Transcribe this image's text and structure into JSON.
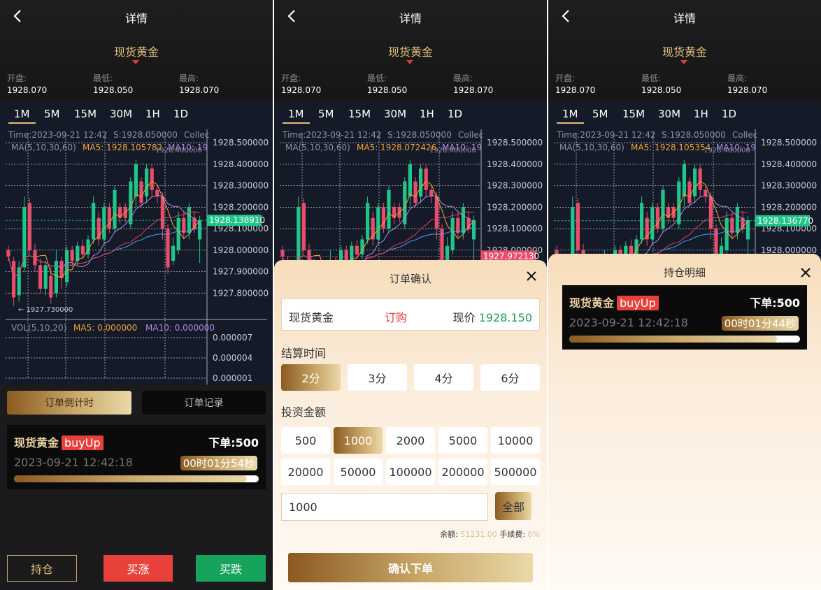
{
  "screens": [
    {
      "header": {
        "title": "详情",
        "symbol": "现货黄金"
      },
      "stats": [
        {
          "label": "开盘:",
          "value": "1928.070"
        },
        {
          "label": "最低:",
          "value": "1928.050"
        },
        {
          "label": "最高:",
          "value": "1928.070"
        }
      ],
      "timeframes": [
        "1M",
        "5M",
        "15M",
        "30M",
        "1H",
        "1D"
      ],
      "info_line": {
        "time": "Time:2023-09-21 12:42",
        "s": "S:1928.050000",
        "extra": "Collec"
      },
      "ma_line": {
        "label": "MA(5,10,30,60)",
        "ma5": "MA5: 1928.105782",
        "ma10": "MA10: 19"
      },
      "last_price": "1928.138910",
      "high_mark": "1928.400000",
      "low_mark": "1927.730000"
    },
    {
      "header": {
        "title": "详情",
        "symbol": "现货黄金"
      },
      "stats": [
        {
          "label": "开盘:",
          "value": "1928.070"
        },
        {
          "label": "最低:",
          "value": "1928.050"
        },
        {
          "label": "最高:",
          "value": "1928.070"
        }
      ],
      "timeframes": [
        "1M",
        "5M",
        "15M",
        "30M",
        "1H",
        "1D"
      ],
      "info_line": {
        "time": "Time:2023-09-21 12:42",
        "s": "S:1928.050000",
        "extra": "Collec"
      },
      "ma_line": {
        "label": "MA(5,10,30,60)",
        "ma5": "MA5: 1928.072426",
        "ma10": "MA10: 19"
      },
      "last_price": "1927.972130",
      "high_mark": "1928.400000"
    },
    {
      "header": {
        "title": "详情",
        "symbol": "现货黄金"
      },
      "stats": [
        {
          "label": "开盘:",
          "value": "1928.070"
        },
        {
          "label": "最低:",
          "value": "1928.050"
        },
        {
          "label": "最高:",
          "value": "1928.070"
        }
      ],
      "timeframes": [
        "1M",
        "5M",
        "15M",
        "30M",
        "1H",
        "1D"
      ],
      "info_line": {
        "time": "Time:2023-09-21 12:42",
        "s": "S:1928.050000",
        "extra": "Collec"
      },
      "ma_line": {
        "label": "MA(5,10,30,60)",
        "ma5": "MA5: 1928.105354",
        "ma10": "MA10: 19"
      },
      "last_price": "1928.136770",
      "high_mark": "1928.400000"
    }
  ],
  "y_ticks": [
    "1928.500000",
    "1928.400000",
    "1928.300000",
    "1928.200000",
    "1928.100000",
    "1928.000000",
    "1927.900000",
    "1927.800000"
  ],
  "vol": {
    "label": "VOL(5,10,20)",
    "ma5": "MA5: 0.000000",
    "ma10": "MA10: 0.000000",
    "ticks": [
      "0.000007",
      "0.000004",
      "0.000001"
    ]
  },
  "orders_tabs": {
    "countdown": "订单倒计时",
    "records": "订单记录"
  },
  "position": {
    "symbol": "现货黄金",
    "direction": "buyUp",
    "order_label": "下单:",
    "order_amount": "500",
    "time": "2023-09-21 12:42:18",
    "countdown": "00时01分54秒",
    "progress": 0.95
  },
  "bottom_buttons": {
    "hold": "持仓",
    "buy_up": "买涨",
    "buy_down": "买跌"
  },
  "order_modal": {
    "title": "订单确认",
    "symbol": "现货黄金",
    "action": "订购",
    "price_label": "现价",
    "price": "1928.150",
    "settle_title": "结算时间",
    "settle_options": [
      "2分",
      "3分",
      "4分",
      "6分"
    ],
    "settle_selected": 0,
    "amount_title": "投资金额",
    "amounts": [
      "500",
      "1000",
      "2000",
      "5000",
      "10000",
      "20000",
      "50000",
      "100000",
      "200000",
      "500000"
    ],
    "amount_selected": 1,
    "input_value": "1000",
    "all_button": "全部",
    "balance_label": "余额:",
    "balance": "51231.00",
    "fee_label": "手续费:",
    "fee": "0%",
    "confirm": "确认下单"
  },
  "holdings_modal": {
    "title": "持仓明细",
    "symbol": "现货黄金",
    "direction": "buyUp",
    "order_label": "下单:",
    "order_amount": "500",
    "time": "2023-09-21 12:42:18",
    "countdown": "00时01分44秒",
    "progress": 0.9
  },
  "candles": [
    {
      "o": 1928.0,
      "c": 1927.97,
      "h": 1928.02,
      "l": 1927.95
    },
    {
      "o": 1927.95,
      "c": 1927.78,
      "h": 1927.97,
      "l": 1927.74
    },
    {
      "o": 1927.79,
      "c": 1927.92,
      "h": 1927.95,
      "l": 1927.76
    },
    {
      "o": 1927.92,
      "c": 1928.2,
      "h": 1928.25,
      "l": 1927.9
    },
    {
      "o": 1928.22,
      "c": 1928.0,
      "h": 1928.24,
      "l": 1927.98
    },
    {
      "o": 1928.0,
      "c": 1927.93,
      "h": 1928.03,
      "l": 1927.9
    },
    {
      "o": 1927.93,
      "c": 1927.82,
      "h": 1927.96,
      "l": 1927.8
    },
    {
      "o": 1927.82,
      "c": 1927.93,
      "h": 1927.95,
      "l": 1927.79
    },
    {
      "o": 1927.88,
      "c": 1927.78,
      "h": 1927.92,
      "l": 1927.75
    },
    {
      "o": 1927.8,
      "c": 1927.95,
      "h": 1928.0,
      "l": 1927.78
    },
    {
      "o": 1927.95,
      "c": 1927.87,
      "h": 1927.97,
      "l": 1927.82
    },
    {
      "o": 1927.85,
      "c": 1928.0,
      "h": 1928.02,
      "l": 1927.83
    },
    {
      "o": 1928.0,
      "c": 1927.95,
      "h": 1928.02,
      "l": 1927.92
    },
    {
      "o": 1927.95,
      "c": 1928.02,
      "h": 1928.04,
      "l": 1927.93
    },
    {
      "o": 1928.02,
      "c": 1927.98,
      "h": 1928.05,
      "l": 1927.96
    },
    {
      "o": 1927.98,
      "c": 1928.05,
      "h": 1928.07,
      "l": 1927.96
    },
    {
      "o": 1928.05,
      "c": 1928.22,
      "h": 1928.25,
      "l": 1928.03
    },
    {
      "o": 1928.15,
      "c": 1928.05,
      "h": 1928.18,
      "l": 1928.02
    },
    {
      "o": 1928.05,
      "c": 1928.2,
      "h": 1928.22,
      "l": 1928.03
    },
    {
      "o": 1928.2,
      "c": 1928.1,
      "h": 1928.22,
      "l": 1928.08
    },
    {
      "o": 1928.1,
      "c": 1928.28,
      "h": 1928.3,
      "l": 1928.08
    },
    {
      "o": 1928.2,
      "c": 1928.15,
      "h": 1928.22,
      "l": 1928.12
    },
    {
      "o": 1928.2,
      "c": 1928.15,
      "h": 1928.22,
      "l": 1928.13
    },
    {
      "o": 1928.12,
      "c": 1928.32,
      "h": 1928.34,
      "l": 1928.1
    },
    {
      "o": 1928.25,
      "c": 1928.4,
      "h": 1928.42,
      "l": 1928.2
    },
    {
      "o": 1928.32,
      "c": 1928.22,
      "h": 1928.34,
      "l": 1928.2
    },
    {
      "o": 1928.25,
      "c": 1928.38,
      "h": 1928.4,
      "l": 1928.22
    },
    {
      "o": 1928.38,
      "c": 1928.28,
      "h": 1928.4,
      "l": 1928.25
    },
    {
      "o": 1928.28,
      "c": 1928.25,
      "h": 1928.3,
      "l": 1928.22
    },
    {
      "o": 1928.25,
      "c": 1928.1,
      "h": 1928.27,
      "l": 1928.05
    },
    {
      "o": 1928.1,
      "c": 1927.92,
      "h": 1928.12,
      "l": 1927.89
    },
    {
      "o": 1927.95,
      "c": 1928.02,
      "h": 1928.06,
      "l": 1927.93
    },
    {
      "o": 1928.0,
      "c": 1928.15,
      "h": 1928.18,
      "l": 1927.98
    },
    {
      "o": 1928.15,
      "c": 1928.08,
      "h": 1928.18,
      "l": 1928.05
    },
    {
      "o": 1928.08,
      "c": 1928.2,
      "h": 1928.22,
      "l": 1928.05
    },
    {
      "o": 1928.15,
      "c": 1928.1,
      "h": 1928.18,
      "l": 1928.08
    },
    {
      "o": 1928.05,
      "c": 1928.14,
      "h": 1928.16,
      "l": 1927.94
    }
  ]
}
